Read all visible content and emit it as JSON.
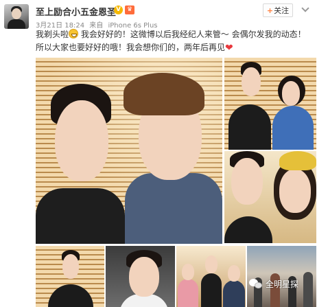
{
  "post": {
    "username": "至上励合小五金恩圣",
    "verified_icon": "verified-v-icon",
    "level_icon": "member-level-icon",
    "date": "3月21日 18:24",
    "source_prefix": "来自",
    "source": "iPhone 6s Plus",
    "follow_label": "关注",
    "follow_plus": "+",
    "text_part1": "我剃头啦",
    "text_part2": "我会好好的！这微博以后我经纪人来管～ 会偶尔发我的动态！所以大家也要好好的哦！我会想你们的，两年后再见",
    "watermark": "全明星探"
  },
  "colors": {
    "accent": "#ff8140",
    "link": "#eb7350",
    "heart": "#e8383d"
  }
}
